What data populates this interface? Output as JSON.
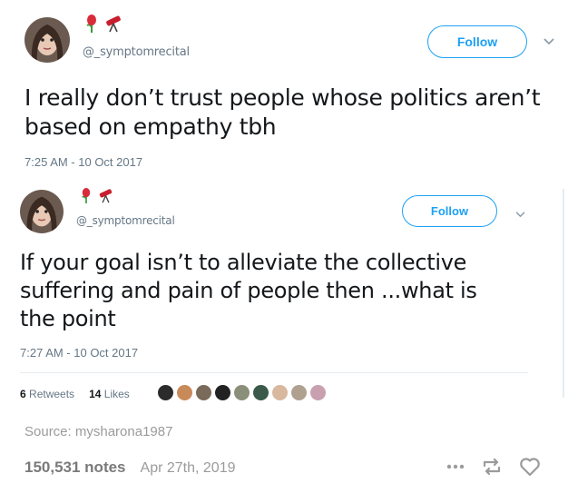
{
  "tweet1": {
    "handle": "@_symptomrecital",
    "follow_label": "Follow",
    "text_line1": "I really don’t trust people whose politics aren’t",
    "text_line2": "based on empathy tbh",
    "timestamp": "7:25 AM - 10 Oct 2017",
    "emoji": [
      "rose-icon",
      "telescope-icon"
    ]
  },
  "tweet2": {
    "handle": "@_symptomrecital",
    "follow_label": "Follow",
    "text_line1": "If your goal isn’t to alleviate the collective",
    "text_line2": "suffering and pain of people then ...what is",
    "text_line3": "the point",
    "timestamp": "7:27 AM - 10 Oct 2017",
    "retweets_count": "6",
    "retweets_label": "Retweets",
    "likes_count": "14",
    "likes_label": "Likes",
    "liker_colors": [
      "#2b2b2b",
      "#c98a5a",
      "#7a6a5a",
      "#222222",
      "#8a8f7a",
      "#3b5a4a",
      "#d9b8a0",
      "#b0a090",
      "#c9a0b0"
    ]
  },
  "post": {
    "source": "Source: mysharona1987",
    "notes": "150,531 notes",
    "date": "Apr 27th, 2019"
  },
  "colors": {
    "twitter_blue": "#1da1f2",
    "muted": "#657786",
    "tumblr_gray": "#9b9b9b"
  }
}
